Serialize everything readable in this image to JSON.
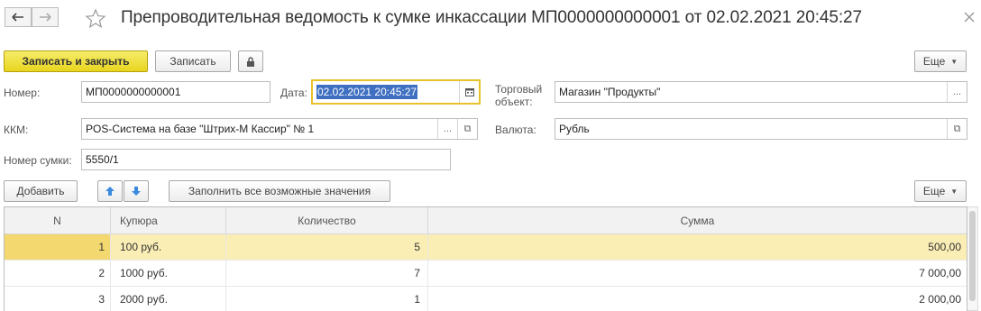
{
  "window": {
    "title": "Препроводительная ведомость к сумке инкассации МП0000000000001 от 02.02.2021 20:45:27",
    "nav_back_icon": "arrow-left-icon",
    "nav_forward_icon": "arrow-right-icon",
    "favorite_icon": "star-icon",
    "close_icon": "close-icon"
  },
  "toolbar": {
    "save_close_label": "Записать и закрыть",
    "save_label": "Записать",
    "lock_icon": "lock-icon",
    "more_label": "Еще"
  },
  "form": {
    "number_label": "Номер:",
    "number_value": "МП0000000000001",
    "date_label": "Дата:",
    "date_value": "02.02.2021 20:45:27",
    "store_label_line1": "Торговый",
    "store_label_line2": "объект:",
    "store_value": "Магазин \"Продукты\"",
    "kkm_label": "ККМ:",
    "kkm_value": "POS-Система на базе \"Штрих-М Кассир\" № 1",
    "currency_label": "Валюта:",
    "currency_value": "Рубль",
    "bag_number_label": "Номер сумки:",
    "bag_number_value": "5550/1",
    "choice_button": "...",
    "open_button": "⧉"
  },
  "table_toolbar": {
    "add_label": "Добавить",
    "fill_label": "Заполнить все возможные значения",
    "more_label": "Еще"
  },
  "table": {
    "columns": [
      "N",
      "Купюра",
      "Количество",
      "Сумма"
    ],
    "rows": [
      {
        "n": "1",
        "note": "100 руб.",
        "qty": "5",
        "sum": "500,00"
      },
      {
        "n": "2",
        "note": "1000 руб.",
        "qty": "7",
        "sum": "7 000,00"
      },
      {
        "n": "3",
        "note": "2000 руб.",
        "qty": "1",
        "sum": "2 000,00"
      }
    ]
  },
  "colors": {
    "primary_button": "#e8d51e",
    "active_field_border": "#e8c22a",
    "selected_row": "#fbeeb5",
    "selection": "#3e6fc1"
  }
}
